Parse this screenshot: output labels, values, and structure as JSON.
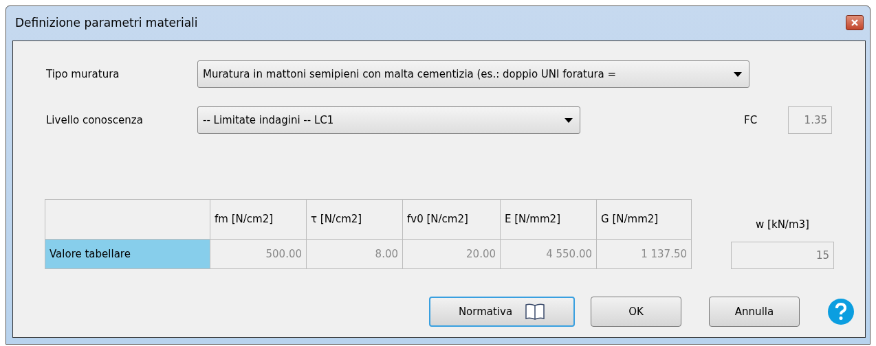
{
  "window": {
    "title": "Definizione parametri materiali"
  },
  "tipo_muratura": {
    "label": "Tipo muratura",
    "value": "Muratura in mattoni semipieni con malta cementizia (es.: doppio UNI foratura ="
  },
  "livello_conoscenza": {
    "label": "Livello conoscenza",
    "value": "-- Limitate indagini -- LC1"
  },
  "fc": {
    "label": "FC",
    "value": "1.35",
    "disabled": true
  },
  "table": {
    "columns": [
      "fm [N/cm2]",
      "τ [N/cm2]",
      "fv0 [N/cm2]",
      "E [N/mm2]",
      "G [N/mm2]"
    ],
    "rows": [
      {
        "label": "Valore tabellare",
        "selected": true,
        "values": [
          "500.00",
          "8.00",
          "20.00",
          "4 550.00",
          "1 137.50"
        ]
      }
    ]
  },
  "w": {
    "label": "w [kN/m3]",
    "value": "15",
    "disabled": true
  },
  "buttons": [
    {
      "label": "Normativa",
      "kind": "book",
      "default": true
    },
    {
      "label": "OK",
      "kind": "plain",
      "default": false
    },
    {
      "label": "Annulla",
      "kind": "plain",
      "default": false
    }
  ]
}
